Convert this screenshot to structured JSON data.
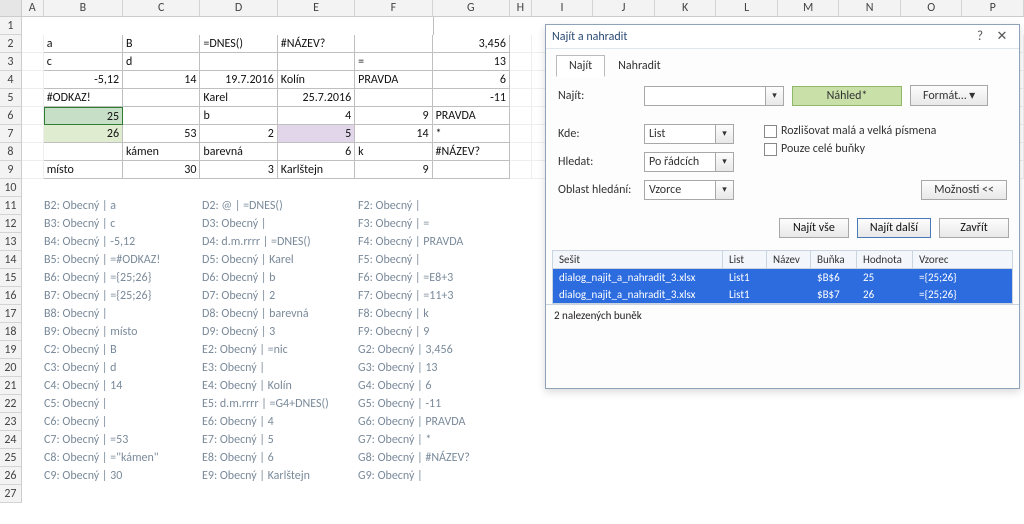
{
  "columns": [
    "A",
    "B",
    "C",
    "D",
    "E",
    "F",
    "G",
    "H",
    "I",
    "J",
    "K",
    "L",
    "M",
    "N",
    "O",
    "P"
  ],
  "rowcount": 27,
  "grid": {
    "2": {
      "B": "a",
      "C": "B",
      "D": "=DNES()",
      "E": "#NÁZEV?",
      "G": "3,456"
    },
    "3": {
      "B": "c",
      "C": "d",
      "F": "=",
      "G": "13"
    },
    "4": {
      "B": "-5,12",
      "C": "14",
      "D": "19.7.2016",
      "E": "Kolín",
      "F": "PRAVDA",
      "G": "6"
    },
    "5": {
      "B": "#ODKAZ!",
      "D": "Karel",
      "E": "25.7.2016",
      "G": "-11"
    },
    "6": {
      "B": "25",
      "D": "b",
      "E": "4",
      "F": "9",
      "G": "PRAVDA"
    },
    "7": {
      "B": "26",
      "C": "53",
      "D": "2",
      "E": "5",
      "F": "14",
      "G": "*"
    },
    "8": {
      "C": "kámen",
      "D": "barevná",
      "E": "6",
      "F": "k",
      "G": "#NÁZEV?"
    },
    "9": {
      "B": "místo",
      "C": "30",
      "D": "3",
      "E": "Karlštejn",
      "F": "9"
    }
  },
  "rightAlign": {
    "2": [
      "G"
    ],
    "3": [
      "G"
    ],
    "4": [
      "B",
      "C",
      "D",
      "G"
    ],
    "5": [
      "E",
      "G"
    ],
    "6": [
      "B",
      "E",
      "F"
    ],
    "7": [
      "B",
      "C",
      "D",
      "E",
      "F"
    ],
    "8": [
      "E"
    ],
    "9": [
      "C",
      "D",
      "F"
    ]
  },
  "info": [
    {
      "row": 11,
      "col": "B",
      "txt": "B2: Obecný | a"
    },
    {
      "row": 11,
      "col": "D",
      "txt": "D2: @ | =DNES()"
    },
    {
      "row": 11,
      "col": "F",
      "txt": "F2: Obecný |"
    },
    {
      "row": 12,
      "col": "B",
      "txt": "B3: Obecný | c"
    },
    {
      "row": 12,
      "col": "D",
      "txt": "D3: Obecný |"
    },
    {
      "row": 12,
      "col": "F",
      "txt": "F3: Obecný | ="
    },
    {
      "row": 13,
      "col": "B",
      "txt": "B4: Obecný | -5,12"
    },
    {
      "row": 13,
      "col": "D",
      "txt": "D4: d.m.rrrr | =DNES()"
    },
    {
      "row": 13,
      "col": "F",
      "txt": "F4: Obecný | PRAVDA"
    },
    {
      "row": 14,
      "col": "B",
      "txt": "B5: Obecný | =#ODKAZ!"
    },
    {
      "row": 14,
      "col": "D",
      "txt": "D5: Obecný | Karel"
    },
    {
      "row": 14,
      "col": "F",
      "txt": "F5: Obecný |"
    },
    {
      "row": 15,
      "col": "B",
      "txt": "B6: Obecný | ={25;26}"
    },
    {
      "row": 15,
      "col": "D",
      "txt": "D6: Obecný | b"
    },
    {
      "row": 15,
      "col": "F",
      "txt": "F6: Obecný | =E8+3"
    },
    {
      "row": 16,
      "col": "B",
      "txt": "B7: Obecný | ={25;26}"
    },
    {
      "row": 16,
      "col": "D",
      "txt": "D7: Obecný | 2"
    },
    {
      "row": 16,
      "col": "F",
      "txt": "F7: Obecný | =11+3"
    },
    {
      "row": 17,
      "col": "B",
      "txt": "B8: Obecný |"
    },
    {
      "row": 17,
      "col": "D",
      "txt": "D8: Obecný | barevná"
    },
    {
      "row": 17,
      "col": "F",
      "txt": "F8: Obecný | k"
    },
    {
      "row": 18,
      "col": "B",
      "txt": "B9: Obecný | místo"
    },
    {
      "row": 18,
      "col": "D",
      "txt": "D9: Obecný | 3"
    },
    {
      "row": 18,
      "col": "F",
      "txt": "F9: Obecný | 9"
    },
    {
      "row": 19,
      "col": "B",
      "txt": "C2: Obecný | B"
    },
    {
      "row": 19,
      "col": "D",
      "txt": "E2: Obecný | =nic"
    },
    {
      "row": 19,
      "col": "F",
      "txt": "G2: Obecný | 3,456"
    },
    {
      "row": 20,
      "col": "B",
      "txt": "C3: Obecný | d"
    },
    {
      "row": 20,
      "col": "D",
      "txt": "E3: Obecný |"
    },
    {
      "row": 20,
      "col": "F",
      "txt": "G3: Obecný | 13"
    },
    {
      "row": 21,
      "col": "B",
      "txt": "C4: Obecný | 14"
    },
    {
      "row": 21,
      "col": "D",
      "txt": "E4: Obecný | Kolín"
    },
    {
      "row": 21,
      "col": "F",
      "txt": "G4: Obecný | 6"
    },
    {
      "row": 22,
      "col": "B",
      "txt": "C5: Obecný |"
    },
    {
      "row": 22,
      "col": "D",
      "txt": "E5: d.m.rrrr | =G4+DNES()"
    },
    {
      "row": 22,
      "col": "F",
      "txt": "G5: Obecný | -11"
    },
    {
      "row": 23,
      "col": "B",
      "txt": "C6: Obecný |"
    },
    {
      "row": 23,
      "col": "D",
      "txt": "E6: Obecný | 4"
    },
    {
      "row": 23,
      "col": "F",
      "txt": "G6: Obecný | PRAVDA"
    },
    {
      "row": 24,
      "col": "B",
      "txt": "C7: Obecný | =53"
    },
    {
      "row": 24,
      "col": "D",
      "txt": "E7: Obecný | 5"
    },
    {
      "row": 24,
      "col": "F",
      "txt": "G7: Obecný | *"
    },
    {
      "row": 25,
      "col": "B",
      "txt": "C8: Obecný | =\"kámen\""
    },
    {
      "row": 25,
      "col": "D",
      "txt": "E8: Obecný | 6"
    },
    {
      "row": 25,
      "col": "F",
      "txt": "G8: Obecný | #NÁZEV?"
    },
    {
      "row": 26,
      "col": "B",
      "txt": "C9: Obecný | 30"
    },
    {
      "row": 26,
      "col": "D",
      "txt": "E9: Obecný | Karlštejn"
    },
    {
      "row": 26,
      "col": "F",
      "txt": "G9: Obecný |"
    }
  ],
  "dialog": {
    "title": "Najít a nahradit",
    "help_icon": "?",
    "close_icon": "✕",
    "tab_find": "Najít",
    "tab_replace": "Nahradit",
    "lbl_find": "Najít:",
    "btn_preview": "Náhled*",
    "btn_format": "Formát…  ▾",
    "lbl_where": "Kde:",
    "val_where": "List",
    "lbl_search": "Hledat:",
    "val_search": "Po řádcích",
    "lbl_lookin": "Oblast hledání:",
    "val_lookin": "Vzorce",
    "chk_case": "Rozlišovat malá a velká písmena",
    "chk_whole": "Pouze celé buňky",
    "btn_options": "Možnosti <<",
    "btn_findall": "Najít vše",
    "btn_findnext": "Najít další",
    "btn_close": "Zavřít",
    "res_hdr": {
      "book": "Sešit",
      "sheet": "List",
      "name": "Název",
      "cell": "Buňka",
      "value": "Hodnota",
      "formula": "Vzorec"
    },
    "res_rows": [
      {
        "book": "dialog_najit_a_nahradit_3.xlsx",
        "sheet": "List1",
        "name": "",
        "cell": "$B$6",
        "value": "25",
        "formula": "={25;26}"
      },
      {
        "book": "dialog_najit_a_nahradit_3.xlsx",
        "sheet": "List1",
        "name": "",
        "cell": "$B$7",
        "value": "26",
        "formula": "={25;26}"
      }
    ],
    "status": "2 nalezených buněk"
  }
}
